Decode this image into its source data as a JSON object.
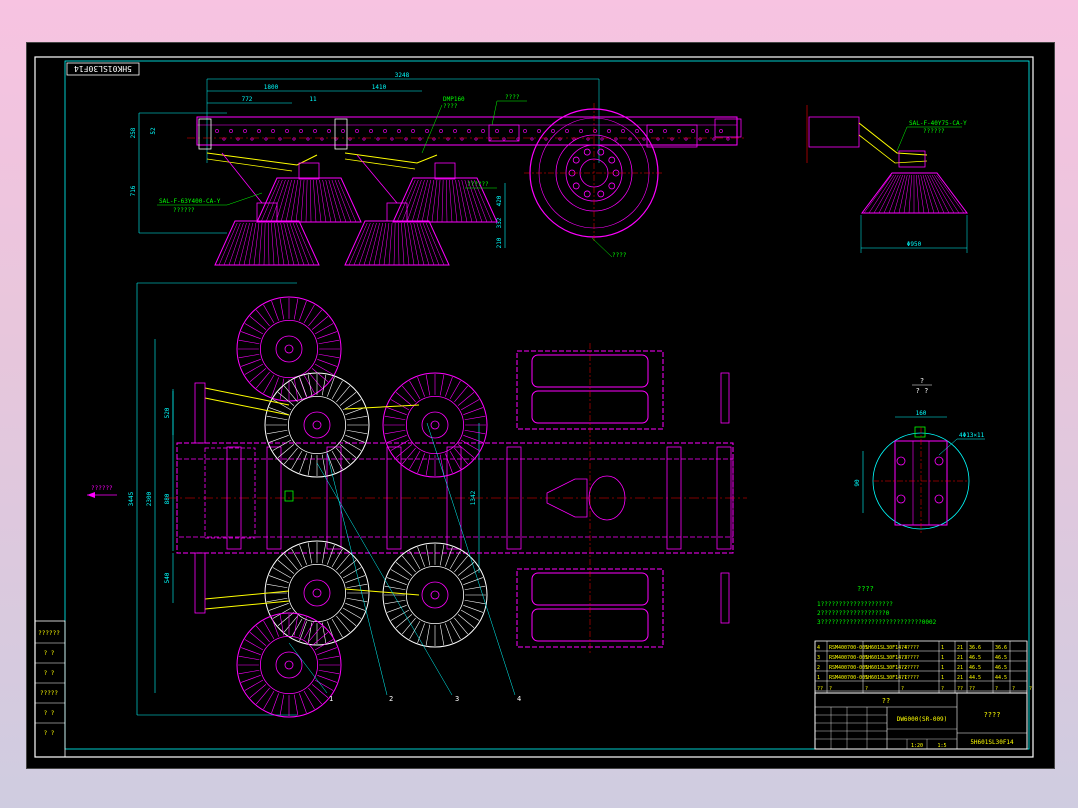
{
  "drawing": {
    "code_stamp": "5HK01SL30F14",
    "colors": {
      "background": "#000000",
      "frame": "#ffffff",
      "frame_inner": "#00ffff",
      "part": "#ff00ff",
      "dimension": "#00ffff",
      "annotation": "#00ff00",
      "centerline": "#ff0000",
      "highlight": "#ffff00"
    }
  },
  "side_view": {
    "dims": {
      "overall": "3248",
      "d1": "1800",
      "d2": "1410",
      "d3": "772",
      "d4": "11",
      "h1": "258",
      "h2": "52",
      "h3": "716",
      "h4": "420",
      "h5": "332",
      "h6": "210"
    },
    "labels": {
      "motor": "DMP160",
      "note_top": "????",
      "left_callout_1": "SAL-F-63Y400-CA-Y",
      "left_callout_2": "??????",
      "right_note": "??????",
      "wheel_note": "????"
    }
  },
  "detail_view": {
    "callout_1": "SAL-F-40Y75-CA-Y",
    "callout_2": "??????",
    "width_dim": "Φ950"
  },
  "plan_view": {
    "direction_label": "??????",
    "dims": {
      "overall_h": "3445",
      "d1": "2300",
      "d2": "880",
      "d3": "520",
      "d4": "540",
      "d5": "1060",
      "d6": "1342"
    },
    "balloons": [
      "1",
      "2",
      "3",
      "4"
    ]
  },
  "section_view": {
    "title": "?",
    "subtitle": "? ?",
    "dims": {
      "width": "160",
      "height": "90",
      "hole": "4Φ13×11"
    }
  },
  "notes": {
    "title": "????",
    "lines": [
      "1????????????????????",
      "2??????????????????0",
      "3????????????????????????????0002"
    ]
  },
  "parts_list": {
    "rows": [
      [
        "4",
        "RSM400700-001",
        "5H601SL30F14.4",
        "??????",
        "1",
        "21",
        "36.6",
        "36.6"
      ],
      [
        "3",
        "RSM400700-001",
        "5H601SL30F14.3",
        "??????",
        "1",
        "21",
        "46.5",
        "46.5"
      ],
      [
        "2",
        "RSM400700-001",
        "5H601SL30F14.2",
        "??????",
        "1",
        "21",
        "46.5",
        "46.5"
      ],
      [
        "1",
        "RSM400700-001",
        "5H601SL30F14.1",
        "??????",
        "1",
        "21",
        "44.5",
        "44.5"
      ]
    ],
    "header": [
      "??",
      "?",
      "?",
      "?",
      "?",
      "??",
      "??",
      "?",
      "?",
      "?",
      "??"
    ]
  },
  "title_block": {
    "org": "??",
    "drawing_no": "DW6000(SR-009)",
    "title": "????",
    "code": "5H601SL30F14",
    "scale": "1:20",
    "sheet": "1:5"
  },
  "left_strip": [
    "??????",
    "? ?",
    "? ?",
    "?????",
    "? ?",
    "? ?"
  ]
}
